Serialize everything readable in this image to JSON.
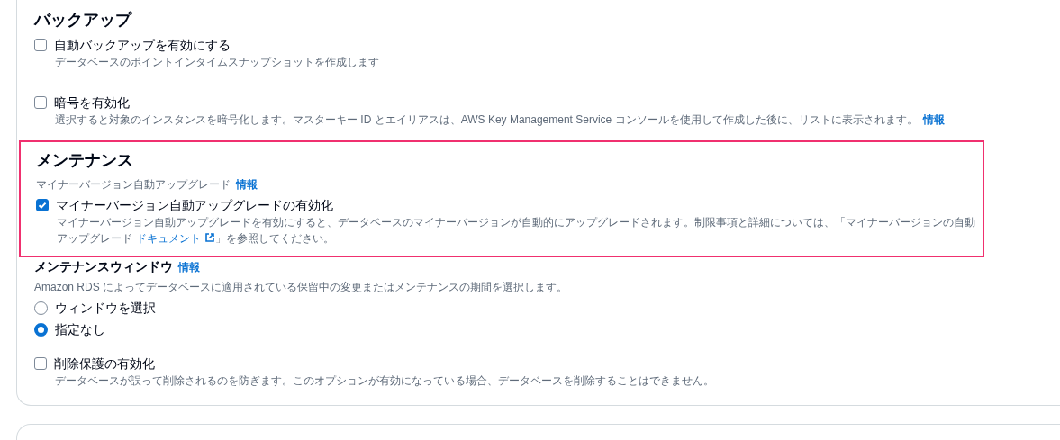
{
  "backup": {
    "title": "バックアップ",
    "options": [
      {
        "label": "自動バックアップを有効にする",
        "description": "データベースのポイントインタイムスナップショットを作成します",
        "checked": false
      },
      {
        "label": "暗号を有効化",
        "description": "選択すると対象のインスタンスを暗号化します。マスターキー ID とエイリアスは、AWS Key Management Service コンソールを使用して作成した後に、リストに表示されます。",
        "info_link": "情報",
        "checked": false
      }
    ]
  },
  "maintenance": {
    "title": "メンテナンス",
    "highlighted": true,
    "field_label": "マイナーバージョン自動アップグレード",
    "info_link": "情報",
    "option": {
      "label": "マイナーバージョン自動アップグレードの有効化",
      "checked": true,
      "description_before": "マイナーバージョン自動アップグレードを有効にすると、データベースのマイナーバージョンが自動的にアップグレードされます。制限事項と詳細については、「マイナーバージョンの自動アップグレード",
      "link": "ドキュメント",
      "description_after": "」を参照してください。"
    }
  },
  "maintenance_window": {
    "label": "メンテナンスウィンドウ",
    "info_link": "情報",
    "description": "Amazon RDS によってデータベースに適用されている保留中の変更またはメンテナンスの期間を選択します。",
    "radios": [
      {
        "label": "ウィンドウを選択",
        "selected": false
      },
      {
        "label": "指定なし",
        "selected": true
      }
    ]
  },
  "deletion_protection": {
    "label": "削除保護の有効化",
    "description": "データベースが誤って削除されるのを防ぎます。このオプションが有効になっている場合、データベースを削除することはできません。",
    "checked": false
  }
}
